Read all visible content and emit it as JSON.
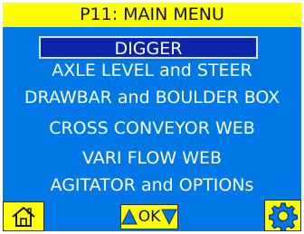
{
  "header": {
    "title": "P11: MAIN MENU"
  },
  "menu": {
    "items": [
      {
        "label": "DIGGER",
        "selected": true
      },
      {
        "label": "AXLE LEVEL and STEER",
        "selected": false
      },
      {
        "label": "DRAWBAR and BOULDER BOX",
        "selected": false
      },
      {
        "label": "CROSS CONVEYOR WEB",
        "selected": false
      },
      {
        "label": "VARI FLOW WEB",
        "selected": false
      },
      {
        "label": "AGITATOR and OPTIONs",
        "selected": false
      }
    ]
  },
  "footer": {
    "ok_label": "OK",
    "icons": {
      "home": "home-icon",
      "up": "up-arrow-icon",
      "down": "down-arrow-icon",
      "settings": "gear-icon"
    }
  },
  "colors": {
    "panel": "#0079e6",
    "title_bg": "#ffff00",
    "selected_bg": "#0b24a8",
    "button_bg": "#ffff00",
    "text": "#ffffff"
  }
}
